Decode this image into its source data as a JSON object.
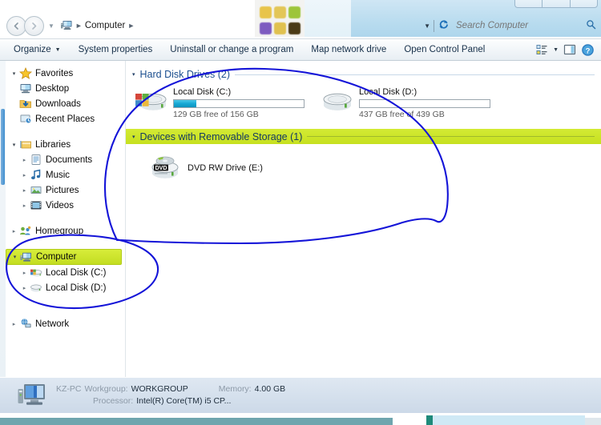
{
  "window": {
    "title": "Computer",
    "controls": [
      "minimize",
      "maximize",
      "close"
    ]
  },
  "address": {
    "back_icon": "back-arrow-icon",
    "forward_icon": "forward-arrow-icon",
    "recent_pages_icon": "chevron-down-icon",
    "computer_icon": "computer-icon",
    "crumb": "Computer",
    "separator": "▸",
    "dropdown_icon": "chevron-down-icon",
    "refresh_icon": "refresh-icon"
  },
  "search": {
    "placeholder": "Search Computer",
    "value": "",
    "icon": "search-icon"
  },
  "toolbar": {
    "organize": "Organize",
    "organize_caret": "▾",
    "system_properties": "System properties",
    "uninstall": "Uninstall or change a program",
    "map_network_drive": "Map network drive",
    "open_control_panel": "Open Control Panel",
    "view_icon": "view-options-icon",
    "view_caret": "▾",
    "preview_pane_icon": "preview-pane-icon",
    "help_icon": "help-icon"
  },
  "sidebar": {
    "groups": [
      {
        "label": "Favorites",
        "icon": "star-icon",
        "expander": "◢",
        "children": [
          {
            "label": "Desktop",
            "icon": "desktop-icon"
          },
          {
            "label": "Downloads",
            "icon": "downloads-icon"
          },
          {
            "label": "Recent Places",
            "icon": "recent-places-icon"
          }
        ]
      },
      {
        "label": "Libraries",
        "icon": "libraries-icon",
        "expander": "◢",
        "children": [
          {
            "label": "Documents",
            "icon": "documents-icon",
            "expander": "▹"
          },
          {
            "label": "Music",
            "icon": "music-icon",
            "expander": "▹"
          },
          {
            "label": "Pictures",
            "icon": "pictures-icon",
            "expander": "▹"
          },
          {
            "label": "Videos",
            "icon": "videos-icon",
            "expander": "▹"
          }
        ]
      }
    ],
    "homegroup": {
      "label": "Homegroup",
      "icon": "homegroup-icon",
      "expander": "▹"
    },
    "computer": {
      "label": "Computer",
      "icon": "computer-icon",
      "expander": "◢",
      "selected": true,
      "children": [
        {
          "label": "Local Disk (C:)",
          "icon": "hard-disk-windows-icon",
          "expander": "▹"
        },
        {
          "label": "Local Disk (D:)",
          "icon": "hard-disk-icon",
          "expander": "▹"
        }
      ]
    },
    "network": {
      "label": "Network",
      "icon": "network-icon",
      "expander": "▹"
    }
  },
  "content": {
    "groups": [
      {
        "title": "Hard Disk Drives (2)",
        "count": 2,
        "caret": "◢",
        "highlighted": false,
        "items": [
          {
            "name": "Local Disk (C:)",
            "icon": "hard-disk-windows-icon",
            "free_text": "129 GB free of 156 GB",
            "free_gb": 129,
            "total_gb": 156,
            "used_percent": 17,
            "bar_color": "#16a8d4"
          },
          {
            "name": "Local Disk (D:)",
            "icon": "hard-disk-icon",
            "free_text": "437 GB free of 439 GB",
            "free_gb": 437,
            "total_gb": 439,
            "used_percent": 0,
            "bar_color": "#16a8d4"
          }
        ]
      },
      {
        "title": "Devices with Removable Storage (1)",
        "count": 1,
        "caret": "◢",
        "highlighted": true,
        "highlight_color": "#c6e01f",
        "items": [
          {
            "name": "DVD RW Drive (E:)",
            "icon": "dvd-drive-icon"
          }
        ]
      }
    ]
  },
  "statusbar": {
    "icon": "computer-large-icon",
    "computer_name": "KZ-PC",
    "workgroup_label": "Workgroup:",
    "workgroup_value": "WORKGROUP",
    "memory_label": "Memory:",
    "memory_value": "4.00 GB",
    "processor_label": "Processor:",
    "processor_value": "Intel(R) Core(TM) i5 CP..."
  },
  "annotations": {
    "color": "#1414d8",
    "shapes": [
      {
        "name": "ellipse-main-content",
        "description": "hand-drawn circle around drives and removable storage"
      },
      {
        "name": "ellipse-sidebar-computer",
        "description": "hand-drawn circle around Computer tree node"
      }
    ]
  }
}
